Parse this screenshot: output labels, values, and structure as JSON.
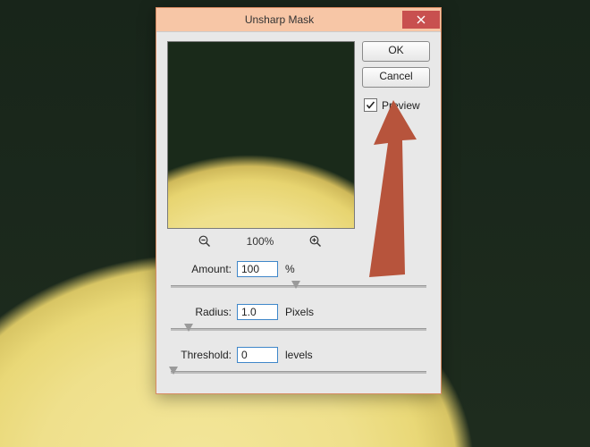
{
  "dialog": {
    "title": "Unsharp Mask",
    "buttons": {
      "ok": "OK",
      "cancel": "Cancel"
    },
    "preview_checkbox": {
      "label": "Preview",
      "checked": true
    },
    "zoom": {
      "level": "100%"
    },
    "amount": {
      "label": "Amount:",
      "value": "100",
      "unit": "%",
      "slider_pos_pct": 49
    },
    "radius": {
      "label": "Radius:",
      "value": "1.0",
      "unit": "Pixels",
      "slider_pos_pct": 7
    },
    "threshold": {
      "label": "Threshold:",
      "value": "0",
      "unit": "levels",
      "slider_pos_pct": 1
    }
  },
  "annotation": {
    "color": "#b7543c"
  }
}
